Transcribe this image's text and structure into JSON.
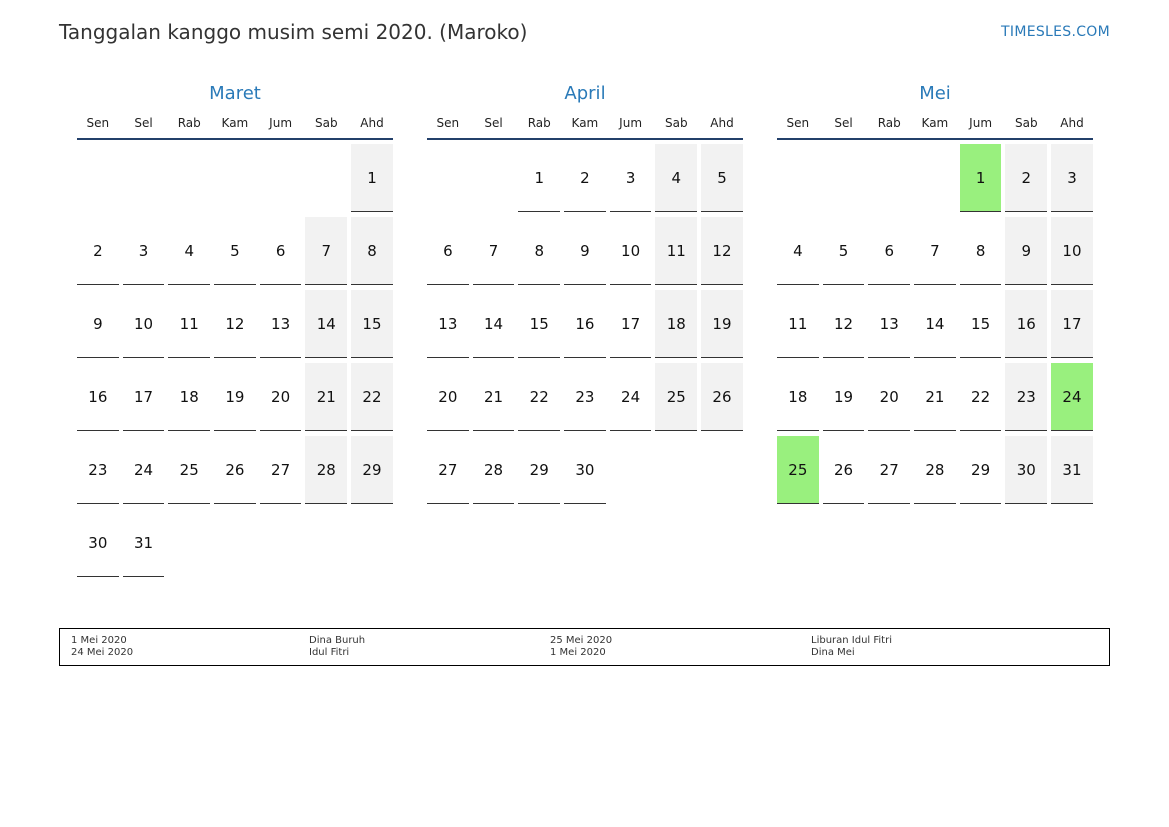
{
  "header": {
    "title": "Tanggalan kanggo musim semi 2020. (Maroko)",
    "site": "TIMESLES.COM"
  },
  "colors": {
    "accent": "#2a7ab8",
    "holiday": "#99f07e",
    "weekend": "#f2f2f2"
  },
  "weekdays": [
    "Sen",
    "Sel",
    "Rab",
    "Kam",
    "Jum",
    "Sab",
    "Ahd"
  ],
  "months": [
    {
      "name": "Maret",
      "offset": 6,
      "days": 31,
      "holidays": []
    },
    {
      "name": "April",
      "offset": 2,
      "days": 30,
      "holidays": []
    },
    {
      "name": "Mei",
      "offset": 4,
      "days": 31,
      "holidays": [
        1,
        24,
        25
      ]
    }
  ],
  "legend": [
    {
      "date": "1 Mei 2020",
      "name": "Dina Buruh"
    },
    {
      "date": "24 Mei 2020",
      "name": "Idul Fitri"
    },
    {
      "date": "25 Mei 2020",
      "name": "Liburan Idul Fitri"
    },
    {
      "date": "1 Mei 2020",
      "name": "Dina Mei"
    }
  ]
}
